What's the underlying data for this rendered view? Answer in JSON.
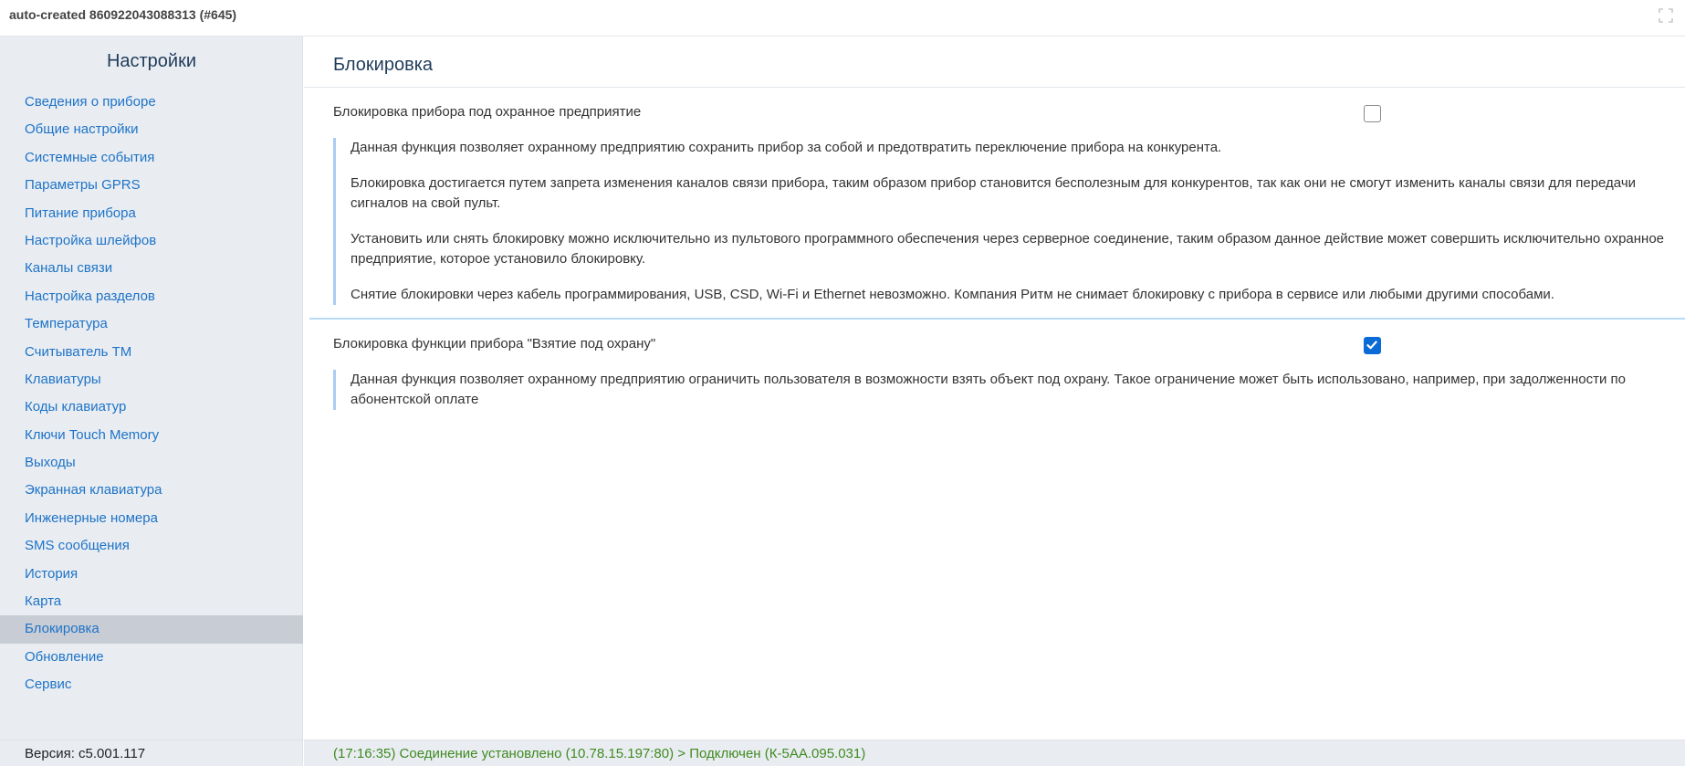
{
  "window": {
    "title": "auto-created 860922043088313 (#645)",
    "fullscreen_icon": "expand-icon"
  },
  "sidebar": {
    "title": "Настройки",
    "items": [
      {
        "label": "Сведения о приборе"
      },
      {
        "label": "Общие настройки"
      },
      {
        "label": "Системные события"
      },
      {
        "label": "Параметры GPRS"
      },
      {
        "label": "Питание прибора"
      },
      {
        "label": "Настройка шлейфов"
      },
      {
        "label": "Каналы связи"
      },
      {
        "label": "Настройка разделов"
      },
      {
        "label": "Температура"
      },
      {
        "label": "Считыватель ТМ"
      },
      {
        "label": "Клавиатуры"
      },
      {
        "label": "Коды клавиатур"
      },
      {
        "label": "Ключи Touch Memory"
      },
      {
        "label": "Выходы"
      },
      {
        "label": "Экранная клавиатура"
      },
      {
        "label": "Инженерные номера"
      },
      {
        "label": "SMS сообщения"
      },
      {
        "label": "История"
      },
      {
        "label": "Карта"
      },
      {
        "label": "Блокировка",
        "active": true
      },
      {
        "label": "Обновление"
      },
      {
        "label": "Сервис"
      }
    ]
  },
  "main": {
    "title": "Блокировка",
    "settings": [
      {
        "label": "Блокировка прибора под охранное предприятие",
        "checked": false,
        "paragraphs": [
          "Данная функция позволяет охранному предприятию сохранить прибор за собой и предотвратить переключение прибора на конкурента.",
          "Блокировка достигается путем запрета изменения каналов связи прибора, таким образом прибор становится бесполезным для конкурентов, так как они не смогут изменить каналы связи для передачи сигналов на свой пульт.",
          "Установить или снять блокировку можно исключительно из пультового программного обеспечения через серверное соединение, таким образом данное действие может совершить исключительно охранное предприятие, которое установило блокировку.",
          "Снятие блокировки через кабель программирования, USB, CSD, Wi-Fi и Ethernet невозможно. Компания Ритм не снимает блокировку с прибора в сервисе или любыми другими способами."
        ]
      },
      {
        "label": "Блокировка функции прибора \"Взятие под охрану\"",
        "checked": true,
        "paragraphs": [
          "Данная функция позволяет охранному предприятию ограничить пользователя в возможности взять объект под охрану. Такое ограничение может быть использовано, например, при задолженности по абонентской оплате"
        ]
      }
    ]
  },
  "statusbar": {
    "version": "Версия: c5.001.117",
    "status": "(17:16:35) Соединение установлено (10.78.15.197:80) > Подключен (К-5АА.095.031)"
  },
  "colors": {
    "accent_link": "#1e73c7",
    "sidebar_bg": "#e9edf2",
    "active_item_bg": "#c8cdd5",
    "status_ok": "#3f8a1f",
    "checkbox_checked": "#0b6bd6",
    "desc_border": "#aacdf0"
  }
}
